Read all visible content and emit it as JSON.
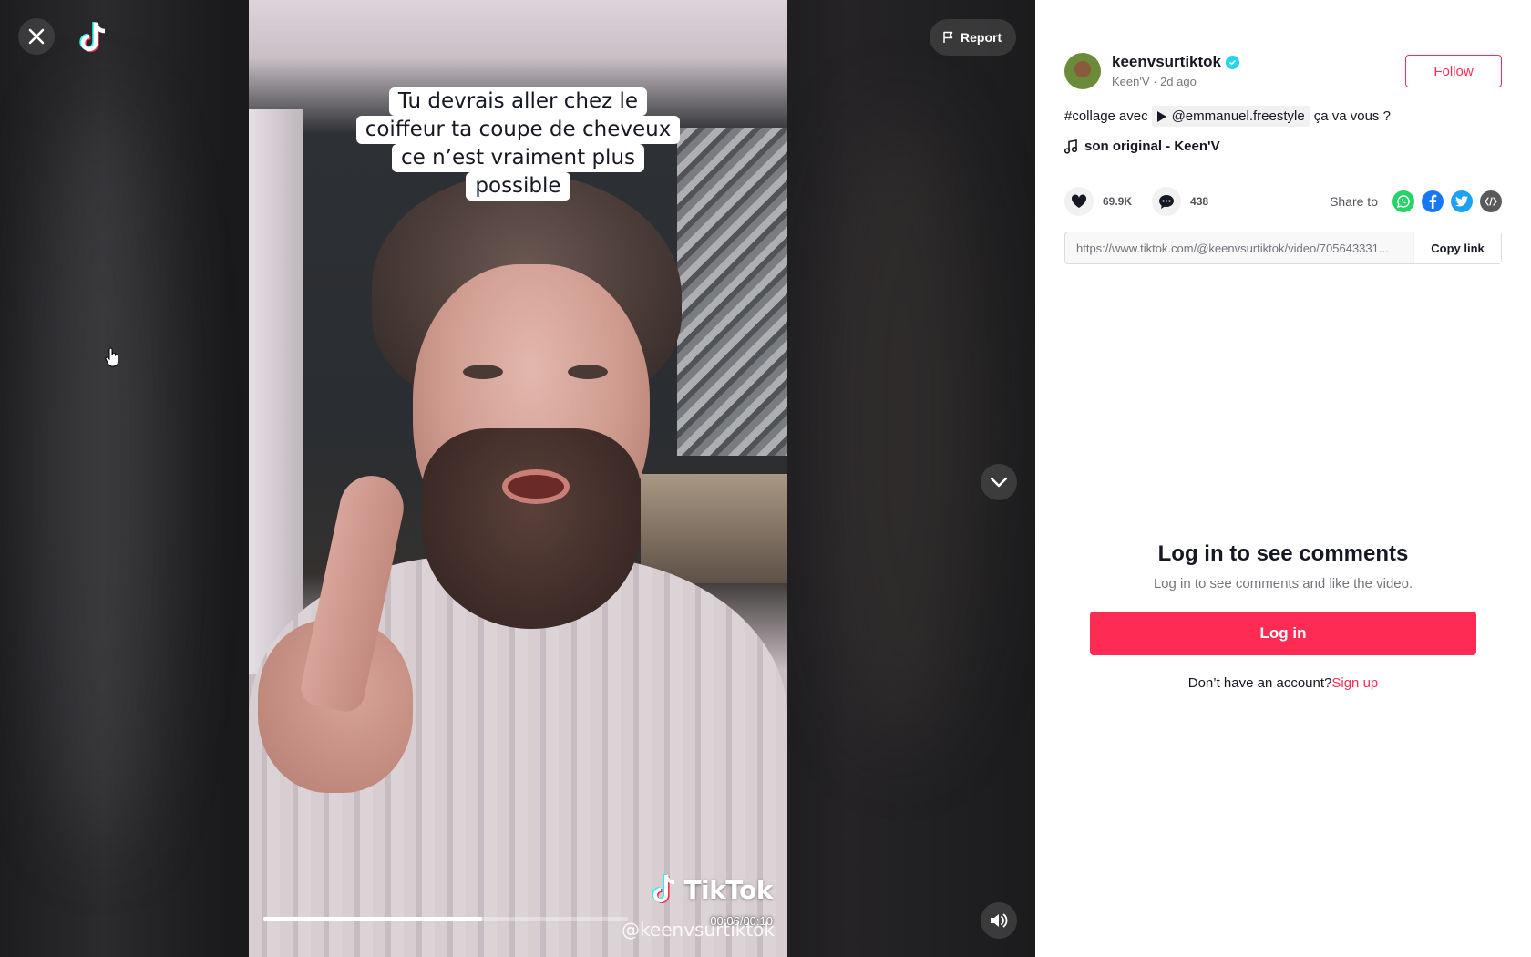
{
  "player": {
    "caption_lines": [
      "Tu devrais aller chez le",
      "coiffeur ta coupe de cheveux",
      "ce n’est vraiment plus",
      "possible"
    ],
    "watermark_text": "TikTok",
    "watermark_handle": "@keenvsurtiktok",
    "time": "00:06/00:10",
    "progress": 0.6,
    "report_label": "Report"
  },
  "author": {
    "username": "keenvsurtiktok",
    "display_name": "Keen'V",
    "age": "2d ago",
    "subline": "Keen'V · 2d ago",
    "follow_label": "Follow"
  },
  "description": {
    "hashtag": "#collage",
    "avec": "avec",
    "mention": "@emmanuel.freestyle",
    "tail": "ça va vous ?"
  },
  "music": {
    "label": "son original - Keen'V"
  },
  "stats": {
    "likes": "69.9K",
    "comments": "438",
    "share_label": "Share to"
  },
  "share_icons": [
    "whatsapp-icon",
    "facebook-icon",
    "twitter-icon",
    "embed-icon"
  ],
  "link": {
    "url": "https://www.tiktok.com/@keenvsurtiktok/video/705643331...",
    "copy_label": "Copy link"
  },
  "login": {
    "title": "Log in to see comments",
    "subtitle": "Log in to see comments and like the video.",
    "button": "Log in",
    "no_account": "Don’t have an account?",
    "signup": "Sign up"
  },
  "colors": {
    "accent": "#fe2c55",
    "verified": "#20d5ec",
    "whatsapp": "#25d366",
    "facebook": "#1877f2",
    "twitter": "#1da1f2",
    "embed": "#5a5a5a"
  }
}
